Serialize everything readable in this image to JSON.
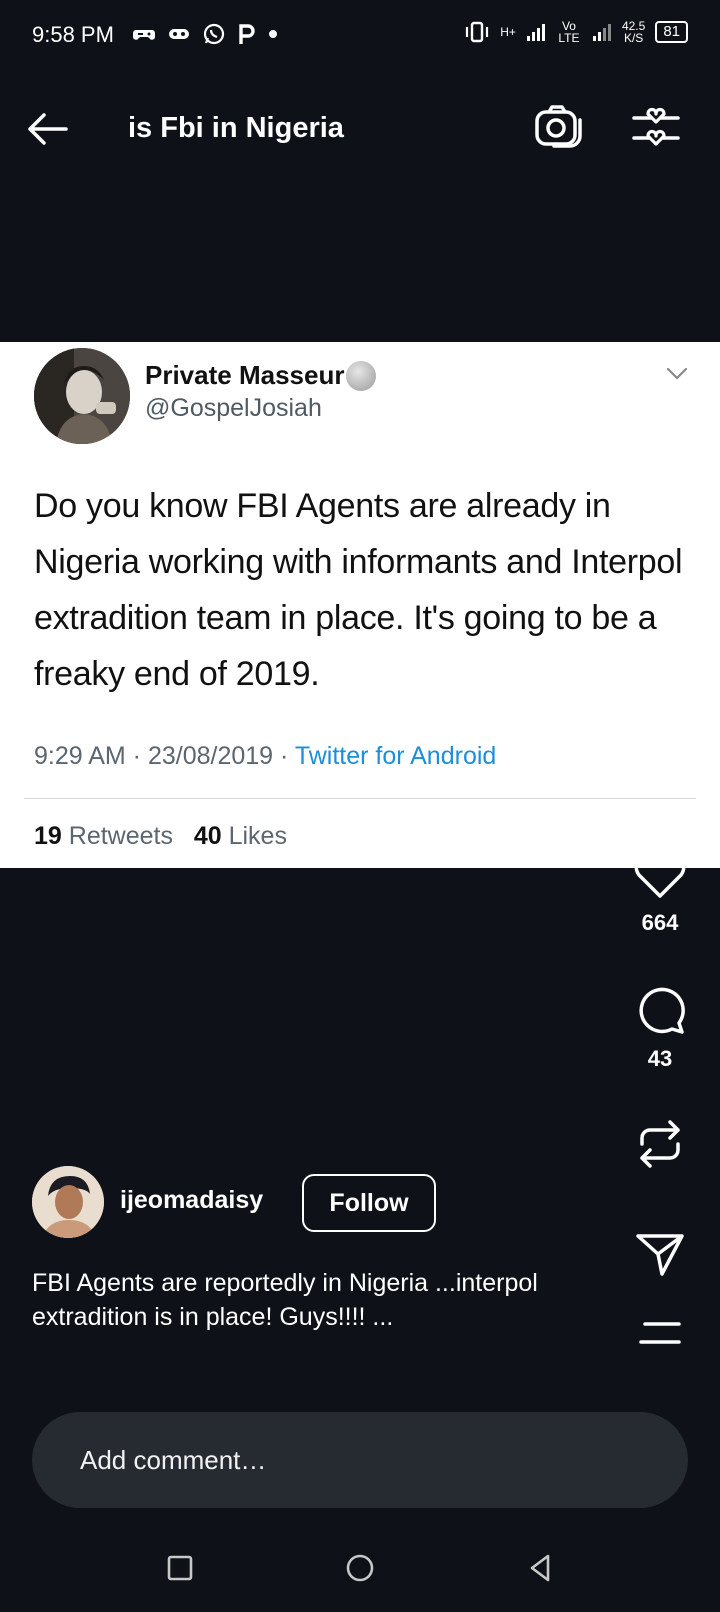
{
  "status_bar": {
    "time": "9:58 PM",
    "network_rate_value": "42.5",
    "network_rate_unit": "K/S",
    "net_type_1": "H+",
    "net_type_2": "Vo LTE",
    "battery": "81"
  },
  "header": {
    "title": "is Fbi in Nigeria"
  },
  "tweet": {
    "display_name": "Private Masseur",
    "handle": "@GospelJosiah",
    "text": "Do you know FBI Agents are already in Nigeria working with informants and Interpol extradition team in place. It's going to be a freaky end of 2019.",
    "time_date": "9:29 AM · 23/08/2019 · ",
    "client": "Twitter for Android",
    "retweets_count": "19",
    "retweets_label": "Retweets",
    "likes_count": "40",
    "likes_label": "Likes"
  },
  "actions": {
    "like_count": "664",
    "comment_count": "43"
  },
  "author": {
    "username": "ijeomadaisy",
    "follow_label": "Follow",
    "caption": "FBI Agents are reportedly in Nigeria ...interpol extradition is in place! Guys!!!! ..."
  },
  "comment": {
    "placeholder": "Add comment…"
  },
  "icons": {
    "back": "arrow-left-icon",
    "camera": "camera-icon",
    "filter": "filter-sliders-icon",
    "like": "heart-icon",
    "comment": "comment-bubble-icon",
    "repost": "repost-icon",
    "share": "send-icon",
    "more": "menu-lines-icon"
  },
  "colors": {
    "background": "#0e1117",
    "tweet_background": "#ffffff",
    "link_blue": "#1d8ed8",
    "comment_box": "#262a31"
  }
}
